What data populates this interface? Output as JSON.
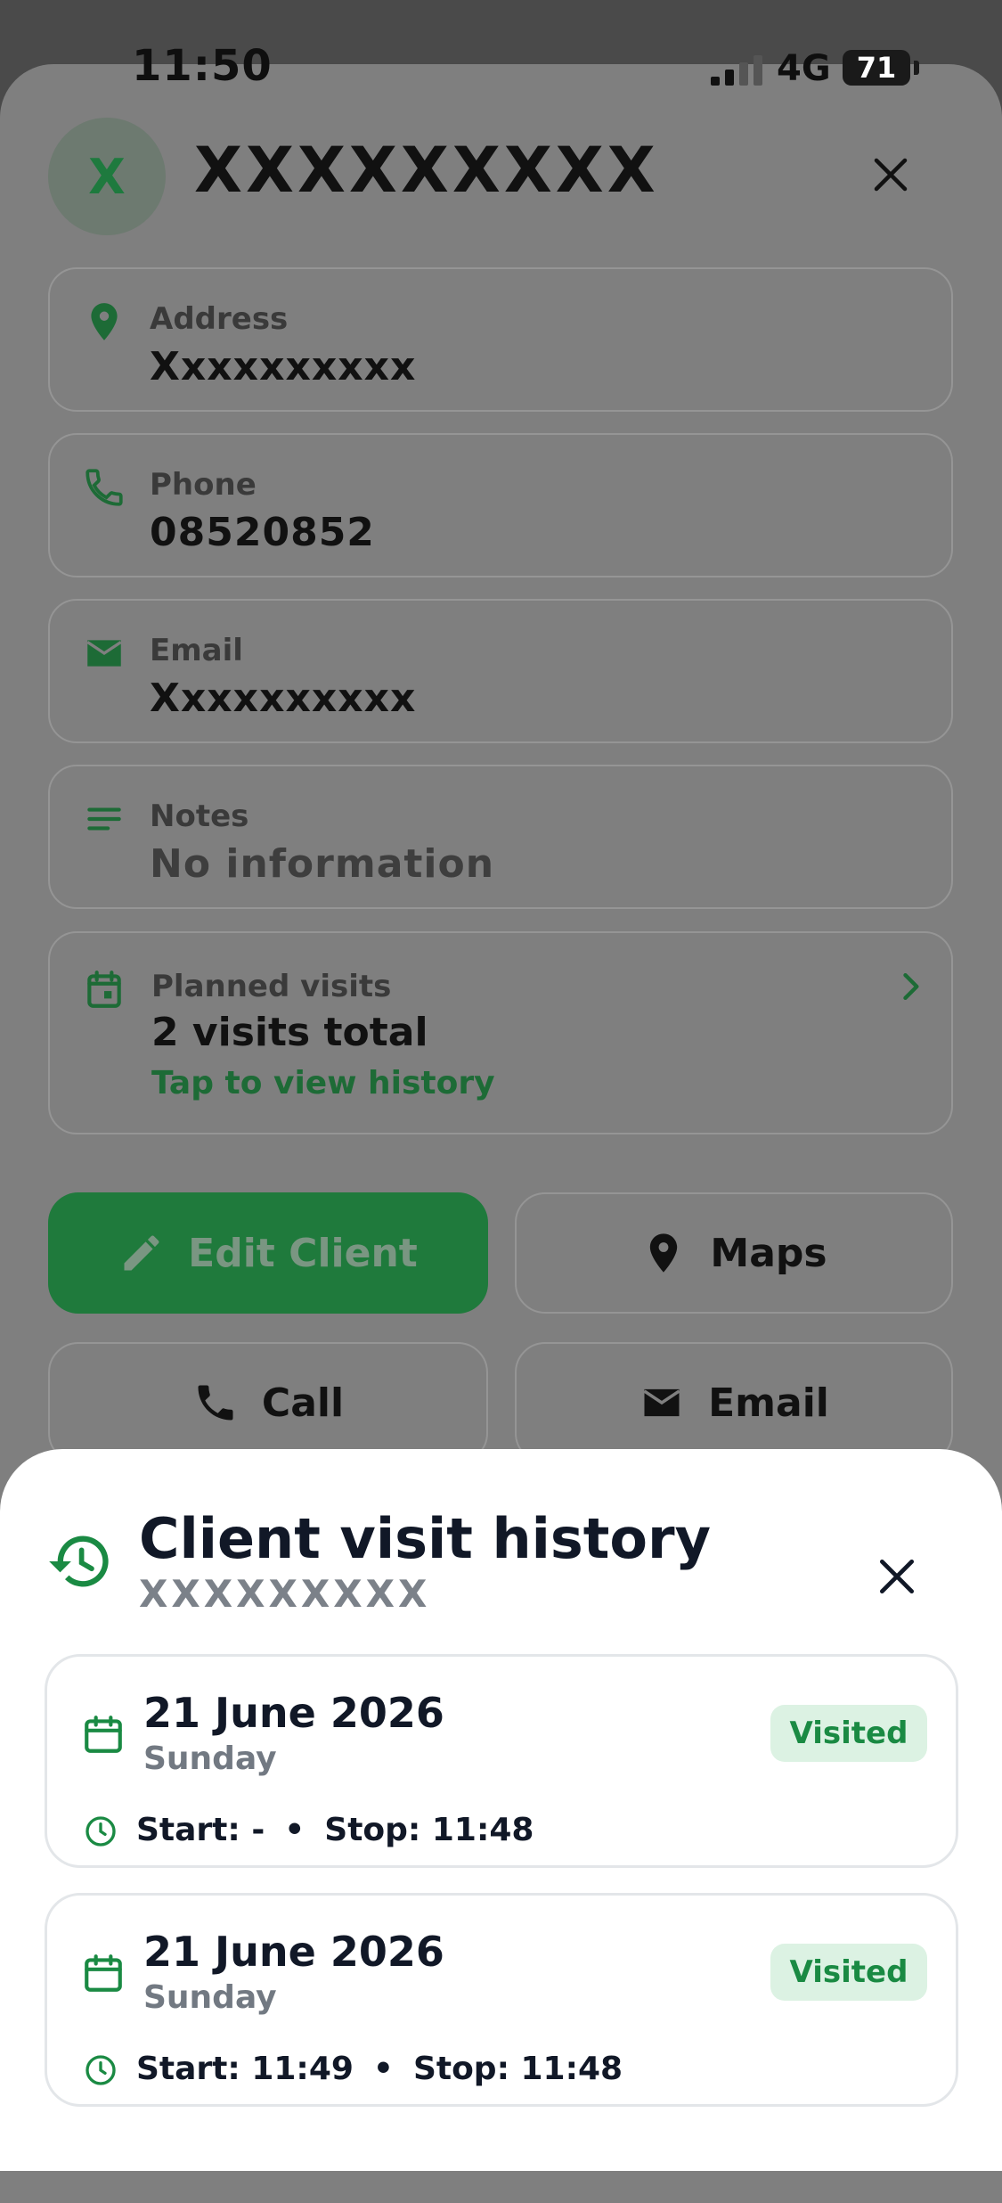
{
  "status_bar": {
    "time": "11:50",
    "network": "4G",
    "battery": "71"
  },
  "client": {
    "avatar_letter": "X",
    "name": "XXXXXXXXX"
  },
  "fields": {
    "address": {
      "label": "Address",
      "value": "Xxxxxxxxxx"
    },
    "phone": {
      "label": "Phone",
      "value": "08520852"
    },
    "email": {
      "label": "Email",
      "value": "Xxxxxxxxxx"
    },
    "notes": {
      "label": "Notes",
      "value": "No information"
    }
  },
  "planned_visits": {
    "label": "Planned visits",
    "value": "2 visits total",
    "link": "Tap to view history"
  },
  "actions": {
    "edit": "Edit Client",
    "maps": "Maps",
    "call": "Call",
    "email": "Email"
  },
  "history_modal": {
    "title": "Client visit history",
    "subtitle": "XXXXXXXXX",
    "visits": [
      {
        "date": "21 June 2026",
        "day": "Sunday",
        "status": "Visited",
        "start": "Start: -",
        "stop": "Stop: 11:48"
      },
      {
        "date": "21 June 2026",
        "day": "Sunday",
        "status": "Visited",
        "start": "Start: 11:49",
        "stop": "Stop: 11:48"
      }
    ]
  },
  "colors": {
    "primary_green": "#1f7a3c",
    "badge_bg": "#dcf2e3",
    "badge_text": "#1a8a43",
    "overlay": "#7f7f7f"
  }
}
